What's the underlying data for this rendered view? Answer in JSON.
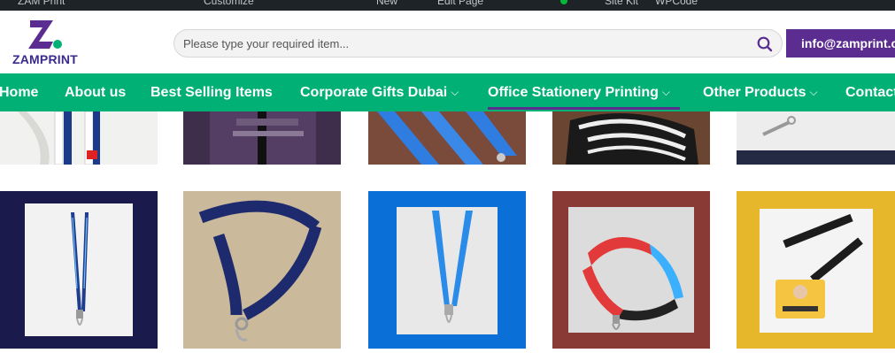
{
  "admin_bar": {
    "items": [
      "ZAM Print",
      "Customize",
      "New",
      "Edit Page",
      "Site Kit",
      "WPCode"
    ]
  },
  "brand": {
    "logo_text": "ZAMPRINT",
    "logo_colors": {
      "primary": "#5b2d90",
      "accent": "#00b074"
    }
  },
  "search": {
    "placeholder": "Please type your required item...",
    "value": ""
  },
  "contact": {
    "email_label": "info@zamprint.com"
  },
  "nav": {
    "items": [
      {
        "label": "Home",
        "has_dropdown": false
      },
      {
        "label": "About us",
        "has_dropdown": false
      },
      {
        "label": "Best Selling Items",
        "has_dropdown": false
      },
      {
        "label": "Corporate Gifts Dubai",
        "has_dropdown": true
      },
      {
        "label": "Office Stationery Printing",
        "has_dropdown": true,
        "active": true
      },
      {
        "label": "Other Products",
        "has_dropdown": true
      },
      {
        "label": "Contact",
        "has_dropdown": false
      }
    ],
    "colors": {
      "bar": "#00b074",
      "active_underline": "#5b2d90"
    }
  },
  "products": {
    "row1": [
      {
        "icon": "lanyard-photo-white-shirt"
      },
      {
        "icon": "lanyard-photo-purple-shirt"
      },
      {
        "icon": "lanyard-photo-blue-bd"
      },
      {
        "icon": "lanyard-photo-black-white"
      },
      {
        "icon": "lanyard-photo-clip-grey"
      }
    ],
    "row2": [
      {
        "icon": "lanyard-photo-navy",
        "bg": "#1a1a4d"
      },
      {
        "icon": "lanyard-photo-magickey",
        "bg": "#c8b89a"
      },
      {
        "icon": "lanyard-photo-blue",
        "bg": "#0a6fd6"
      },
      {
        "icon": "lanyard-photo-gamers",
        "bg": "#8a3a35"
      },
      {
        "icon": "lanyard-photo-id-badge",
        "bg": "#e6b72a"
      }
    ]
  }
}
